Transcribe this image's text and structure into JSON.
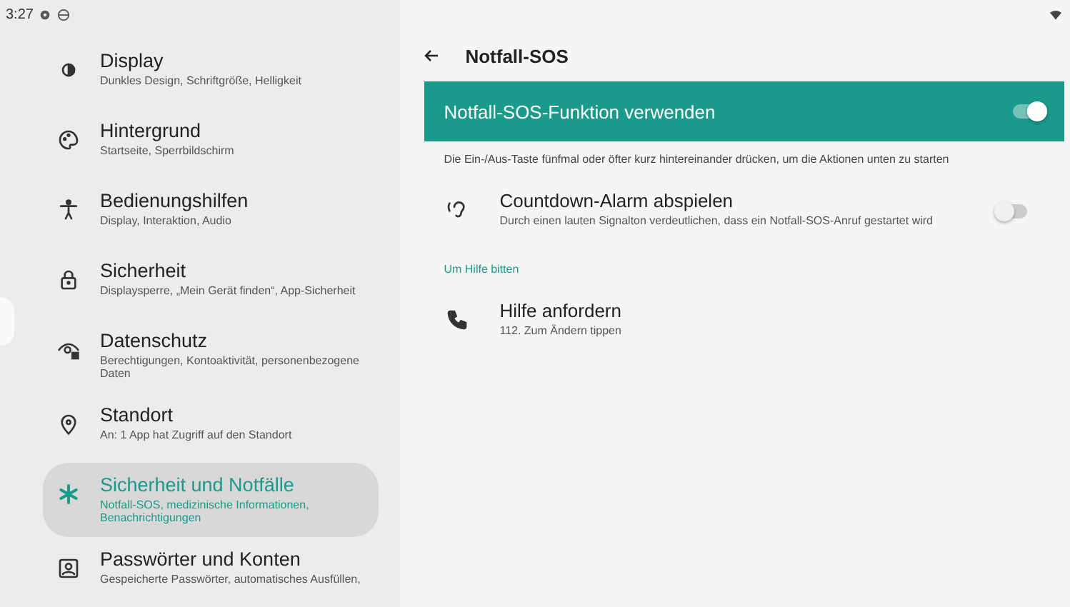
{
  "status_bar": {
    "time": "3:27"
  },
  "sidebar": {
    "items": [
      {
        "title": "Display",
        "subtitle": "Dunkles Design, Schriftgröße, Helligkeit",
        "selected": false
      },
      {
        "title": "Hintergrund",
        "subtitle": "Startseite, Sperrbildschirm",
        "selected": false
      },
      {
        "title": "Bedienungshilfen",
        "subtitle": "Display, Interaktion, Audio",
        "selected": false
      },
      {
        "title": "Sicherheit",
        "subtitle": "Displaysperre, „Mein Gerät finden“, App-Sicherheit",
        "selected": false
      },
      {
        "title": "Datenschutz",
        "subtitle": "Berechtigungen, Kontoaktivität, personenbezogene Daten",
        "selected": false
      },
      {
        "title": "Standort",
        "subtitle": "An: 1 App hat Zugriff auf den Standort",
        "selected": false
      },
      {
        "title": "Sicherheit und Notfälle",
        "subtitle": "Notfall-SOS, medizinische Informationen, Benachrichtigungen",
        "selected": true
      },
      {
        "title": "Passwörter und Konten",
        "subtitle": "Gespeicherte Passwörter, automatisches Ausfüllen,",
        "selected": false
      }
    ]
  },
  "detail": {
    "title": "Notfall-SOS",
    "main_switch": {
      "label": "Notfall-SOS-Funktion verwenden",
      "on": true
    },
    "description": "Die Ein-/Aus-Taste fünfmal oder öfter kurz hintereinander drücken, um die Aktionen unten zu starten",
    "settings": [
      {
        "kind": "toggle",
        "title": "Countdown-Alarm abspielen",
        "subtitle": "Durch einen lauten Signalton verdeutlichen, dass ein Notfall-SOS-Anruf gestartet wird",
        "on": false
      },
      {
        "kind": "header",
        "title": "Um Hilfe bitten"
      },
      {
        "kind": "action",
        "title": "Hilfe anfordern",
        "subtitle": "112. Zum Ändern tippen"
      }
    ]
  }
}
